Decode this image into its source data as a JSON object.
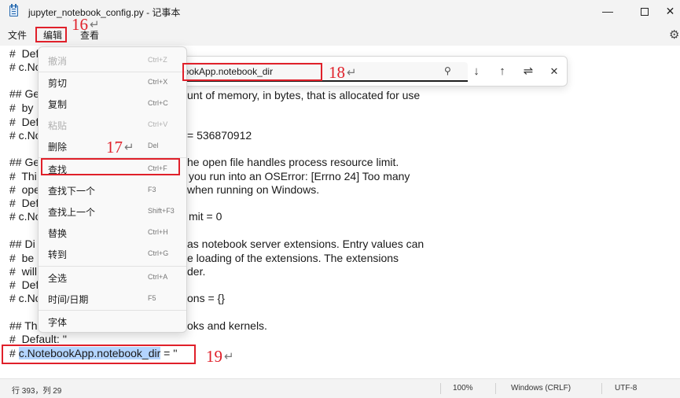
{
  "window": {
    "title": "jupyter_notebook_config.py - 记事本",
    "minimize_glyph": "—",
    "close_glyph": "✕",
    "app_icon": "notepad-icon"
  },
  "menubar": {
    "file": "文件",
    "edit": "编辑",
    "view": "查看",
    "settings_icon": "gear-icon"
  },
  "editor": {
    "lines": [
      "#  Def",
      "# c.No",
      "",
      "## Ge",
      "#  by",
      "#  Def",
      "# c.No",
      "",
      "## Ge",
      "#  Thi",
      "#  ope",
      "#  Def",
      "# c.No",
      "",
      "## Di",
      "#  be",
      "#  will",
      "#  Def",
      "# c.No",
      "",
      "## Th",
      "#  Default: ''"
    ],
    "right_fragments": {
      "l4": "unt of memory, in bytes, that is allocated for use",
      "l7": "= 536870912",
      "l9": "he open file handles process resource limit.",
      "l10": "you run into an OSError: [Errno 24] Too many",
      "l11": "when running on Windows.",
      "l13": "mit = 0",
      "l15": "as notebook server extensions. Entry values can",
      "l16": "e loading of the extensions. The extensions",
      "l17": "der.",
      "l19": "ons = {}",
      "l21": "oks and kernels."
    },
    "last_line_prefix": "# ",
    "last_line_selected": "c.NotebookApp.notebook_dir",
    "last_line_suffix": " = ''"
  },
  "edit_menu": {
    "items": [
      {
        "label": "撤消",
        "shortcut": "Ctrl+Z",
        "enabled": false
      },
      {
        "label": "剪切",
        "shortcut": "Ctrl+X",
        "enabled": true
      },
      {
        "label": "复制",
        "shortcut": "Ctrl+C",
        "enabled": true
      },
      {
        "label": "粘贴",
        "shortcut": "Ctrl+V",
        "enabled": false
      },
      {
        "label": "删除",
        "shortcut": "Del",
        "enabled": true
      },
      {
        "label": "查找",
        "shortcut": "Ctrl+F",
        "enabled": true
      },
      {
        "label": "查找下一个",
        "shortcut": "F3",
        "enabled": true
      },
      {
        "label": "查找上一个",
        "shortcut": "Shift+F3",
        "enabled": true
      },
      {
        "label": "替换",
        "shortcut": "Ctrl+H",
        "enabled": true
      },
      {
        "label": "转到",
        "shortcut": "Ctrl+G",
        "enabled": true
      },
      {
        "label": "全选",
        "shortcut": "Ctrl+A",
        "enabled": true
      },
      {
        "label": "时间/日期",
        "shortcut": "F5",
        "enabled": true
      },
      {
        "label": "字体",
        "shortcut": "",
        "enabled": true
      }
    ]
  },
  "find_bar": {
    "value": "bookApp.notebook_dir",
    "search_icon": "search-icon",
    "next_glyph": "↓",
    "prev_glyph": "↑",
    "options_glyph": "⇌",
    "close_glyph": "✕"
  },
  "annotations": {
    "n16": "16",
    "n17": "17",
    "n18": "18",
    "n19": "19",
    "arrow": "↵",
    "color": "#e0202a"
  },
  "status": {
    "position": "行 393，列 29",
    "zoom": "100%",
    "line_ending": "Windows (CRLF)",
    "encoding": "UTF-8"
  }
}
